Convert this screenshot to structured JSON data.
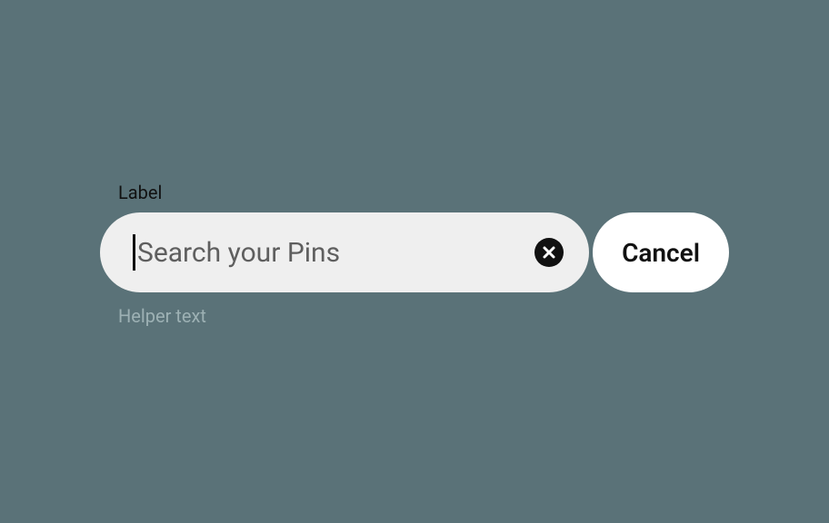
{
  "search": {
    "label": "Label",
    "placeholder": "Search your Pins",
    "helper": "Helper text",
    "cancel": "Cancel"
  }
}
